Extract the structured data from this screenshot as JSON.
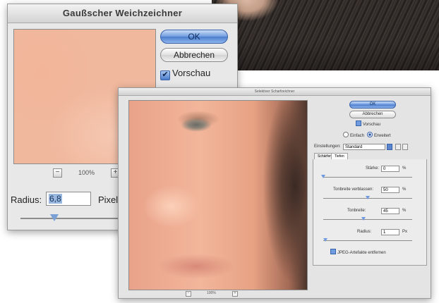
{
  "gauss_dialog": {
    "title": "Gaußscher Weichzeichner",
    "ok_label": "OK",
    "cancel_label": "Abbrechen",
    "preview_label": "Vorschau",
    "preview_checked": true,
    "zoom": "100%",
    "zoom_out": "−",
    "zoom_in": "+",
    "radius_label": "Radius:",
    "radius_value": "6,8",
    "unit_label": "Pixel",
    "slider_fraction": 0.3
  },
  "sharpen_dialog": {
    "title": "Selektiver Scharfzeichner",
    "ok_label": "OK",
    "cancel_label": "Abbrechen",
    "preview_label": "Vorschau",
    "mode_simple": "Einfach",
    "mode_advanced": "Erweitert",
    "mode_selected": "advanced",
    "settings_label": "Einstellungen:",
    "settings_value": "Standard",
    "tabs": [
      {
        "label": "Schärfen",
        "active": false
      },
      {
        "label": "Tiefen",
        "active": true
      }
    ],
    "zoom": "100%",
    "zoom_out": "−",
    "zoom_in": "+",
    "controls": [
      {
        "label": "Stärke:",
        "value": "0",
        "unit": "%",
        "fraction": 0.0
      },
      {
        "label": "Tonbreite verblassen:",
        "value": "50",
        "unit": "%",
        "fraction": 0.5
      },
      {
        "label": "Tonbreite:",
        "value": "45",
        "unit": "%",
        "fraction": 0.45
      },
      {
        "label": "Radius:",
        "value": "1",
        "unit": "Px",
        "fraction": 0.02
      }
    ],
    "remove_jpeg_label": "JPEG-Artefakte entfernen",
    "remove_jpeg_checked": true
  }
}
